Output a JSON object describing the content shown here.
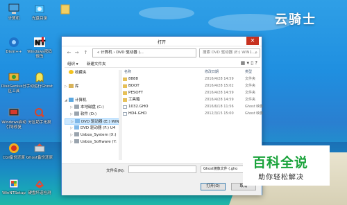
{
  "desktop": {
    "brand_text": "云骑士",
    "icons": [
      {
        "label": "计算机",
        "icon": "computer-icon"
      },
      {
        "label": "光盘目录",
        "icon": "cd-icon"
      },
      {
        "label": "",
        "icon": "folder-icon"
      },
      {
        "label": "Dism++",
        "icon": "dism-icon"
      },
      {
        "label": "Windows密码修改",
        "icon": "ntpwedit-icon"
      },
      {
        "label": "DiskGenius分区工具",
        "icon": "diskgenius-icon"
      },
      {
        "label": "手动运行Ghost",
        "icon": "ghost-icon"
      },
      {
        "label": "Windows启动引导修复",
        "icon": "bootfix-icon"
      },
      {
        "label": "分区助手无损",
        "icon": "partition-icon"
      },
      {
        "label": "CGI备份还原",
        "icon": "cgi-icon"
      },
      {
        "label": "Ghost备份还原",
        "icon": "ghost-backup-icon"
      },
      {
        "label": "WinNTSetup",
        "icon": "winntsetup-icon"
      },
      {
        "label": "硬盘坏道检测",
        "icon": "disk-check-icon"
      }
    ]
  },
  "dialog": {
    "title": "打开",
    "close_glyph": "✕",
    "breadcrumb": "« 计算机 › DVD 驱动器 (...",
    "search_placeholder": "搜索 DVD 驱动器 (E:) WIN1...",
    "toolbar": {
      "organize": "组织 ▾",
      "new_folder": "新建文件夹"
    },
    "nav_items": [
      {
        "label": "收藏夹",
        "chev": "",
        "icon": "star-icon",
        "selected": false
      },
      {
        "label": "库",
        "chev": "▷",
        "icon": "library-icon",
        "selected": false
      },
      {
        "label": "计算机",
        "chev": "◢",
        "icon": "computer-icon",
        "selected": false
      },
      {
        "label": "本地磁盘 (C:)",
        "chev": "▷",
        "icon": "drive-icon",
        "selected": false
      },
      {
        "label": "软件 (D:)",
        "chev": "▷",
        "icon": "drive-icon",
        "selected": false
      },
      {
        "label": "DVD 驱动器 (E:) WIN",
        "chev": "▷",
        "icon": "dvd-icon",
        "selected": true
      },
      {
        "label": "DVD 驱动器 (F:) U4",
        "chev": "▷",
        "icon": "dvd-icon",
        "selected": false
      },
      {
        "label": "Usbos_System (X:)",
        "chev": "▷",
        "icon": "drive-icon",
        "selected": false
      },
      {
        "label": "Usbos_Software (Y:",
        "chev": "▷",
        "icon": "drive-icon",
        "selected": false
      }
    ],
    "columns": {
      "name": "名称",
      "date": "修改日期",
      "type": "类型"
    },
    "files": [
      {
        "name": "8888",
        "date": "2016/4/28 14:59",
        "type": "文件夹",
        "kind": "folder"
      },
      {
        "name": "BOOT",
        "date": "2016/4/28 15:02",
        "type": "文件夹",
        "kind": "folder"
      },
      {
        "name": "PESOFT",
        "date": "2016/4/28 14:59",
        "type": "文件夹",
        "kind": "folder"
      },
      {
        "name": "工具箱",
        "date": "2016/4/28 14:59",
        "type": "文件夹",
        "kind": "folder"
      },
      {
        "name": "1032.GHO",
        "date": "2016/6/18 11:56",
        "type": "Ghost 映像",
        "kind": "gho"
      },
      {
        "name": "HD4.GHO",
        "date": "2012/3/15 15:00",
        "type": "Ghost 映像",
        "kind": "gho"
      }
    ],
    "filename_label": "文件名(N):",
    "filename_value": "",
    "filetype_value": "Ghost镜像文件 (.gho",
    "open_button": "打开(O)",
    "cancel_button": "取消"
  },
  "watermark": {
    "title": "百科全说",
    "subtitle": "助你轻松解决"
  }
}
